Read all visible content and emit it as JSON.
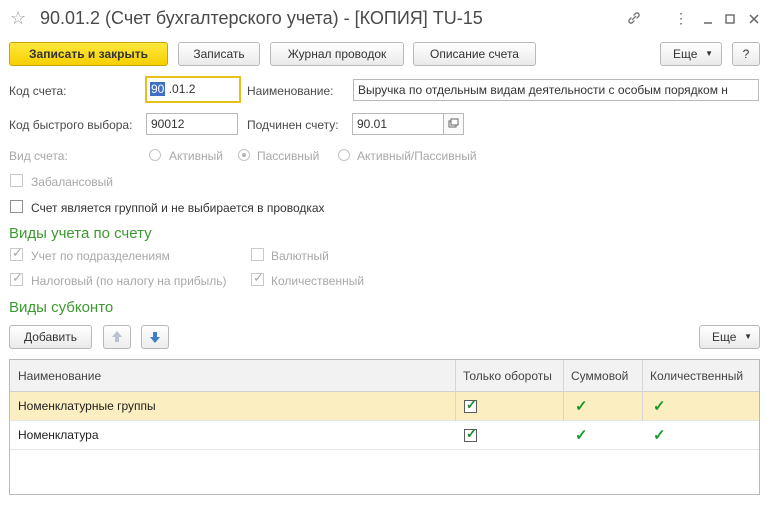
{
  "window": {
    "title": "90.01.2 (Счет бухгалтерского учета) - [КОПИЯ] TU-15"
  },
  "toolbar": {
    "save_close": "Записать и закрыть",
    "save": "Записать",
    "journal": "Журнал проводок",
    "description": "Описание счета",
    "more": "Еще",
    "help": "?"
  },
  "form": {
    "code_label": "Код счета:",
    "code_value_selected": "90",
    "code_value_rest": " .01.2",
    "name_label": "Наименование:",
    "name_value": "Выручка по отдельным видам деятельности с особым порядком н",
    "quick_label": "Код быстрого выбора:",
    "quick_value": "90012",
    "parent_label": "Подчинен счету:",
    "parent_value": "90.01",
    "type_label": "Вид счета:",
    "type_options": [
      "Активный",
      "Пассивный",
      "Активный/Пассивный"
    ],
    "offbalance_label": "Забалансовый",
    "group_label": "Счет является группой и не выбирается в проводках"
  },
  "accounting": {
    "title": "Виды учета по счету",
    "by_division": "Учет по подразделениям",
    "currency": "Валютный",
    "tax": "Налоговый (по налогу на прибыль)",
    "quantity": "Количественный"
  },
  "subconto": {
    "title": "Виды субконто",
    "add": "Добавить",
    "more": "Еще",
    "columns": [
      "Наименование",
      "Только обороты",
      "Суммовой",
      "Количественный"
    ],
    "rows": [
      {
        "name": "Номенклатурные группы"
      },
      {
        "name": "Номенклатура"
      }
    ]
  },
  "colors": {
    "accent_yellow": "#f5cf00",
    "section_green": "#3b9a2f",
    "row_highlight": "#fbeec0",
    "check_green": "#1a9a2c"
  }
}
